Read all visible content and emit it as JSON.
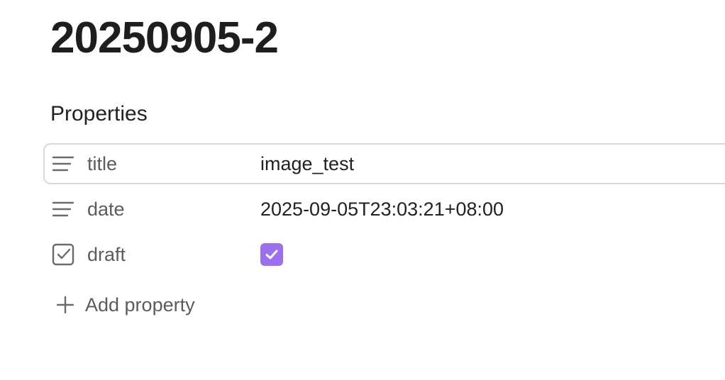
{
  "note": {
    "title": "20250905-2"
  },
  "properties": {
    "heading": "Properties",
    "items": [
      {
        "icon": "text-lines-icon",
        "key": "title",
        "value": "image_test"
      },
      {
        "icon": "text-lines-icon",
        "key": "date",
        "value": "2025-09-05T23:03:21+08:00"
      },
      {
        "icon": "checkbox-square-icon",
        "key": "draft",
        "checked": true
      }
    ],
    "add_label": "Add property"
  },
  "colors": {
    "checkbox_fill": "#9b6ff0",
    "row_focus_border": "#d9d9d9",
    "key_text": "#5c5c5c"
  }
}
